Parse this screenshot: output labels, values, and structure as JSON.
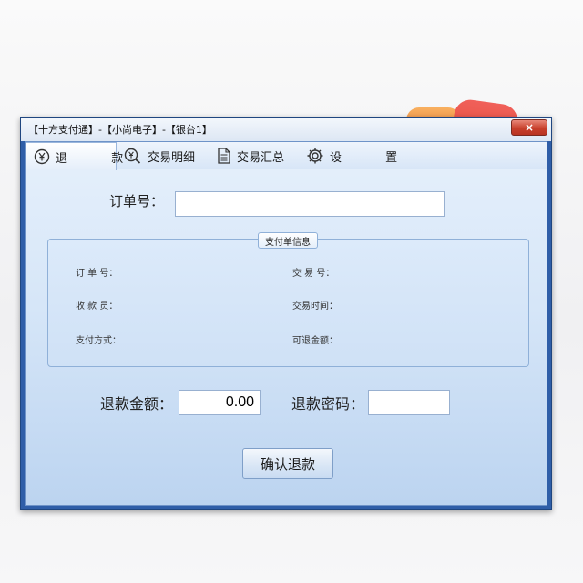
{
  "window": {
    "title": "【十方支付通】-【小尚电子】-【银台1】",
    "close_glyph": "×"
  },
  "tabs": [
    {
      "label": "退 款",
      "icon": "yen-circle-icon",
      "active": true
    },
    {
      "label": "交易明细",
      "icon": "search-yen-icon",
      "active": false
    },
    {
      "label": "交易汇总",
      "icon": "document-icon",
      "active": false
    },
    {
      "label": "设 置",
      "icon": "gear-icon",
      "active": false
    }
  ],
  "order": {
    "label": "订单号：",
    "value": ""
  },
  "payment_info": {
    "title": "支付单信息",
    "fields": {
      "order_no": "订 单 号：",
      "cashier": "收 款 员：",
      "pay_method": "支付方式：",
      "trade_no": "交 易 号：",
      "trade_time": "交易时间：",
      "refundable": "可退金额："
    }
  },
  "refund": {
    "amount_label": "退款金额：",
    "amount_value": "0.00",
    "password_label": "退款密码：",
    "password_value": ""
  },
  "confirm_button": "确认退款",
  "colors": {
    "frame": "#2f5ea8",
    "client_top": "#e6f0fb",
    "client_bottom": "#bcd4f0",
    "close": "#c8402c"
  }
}
